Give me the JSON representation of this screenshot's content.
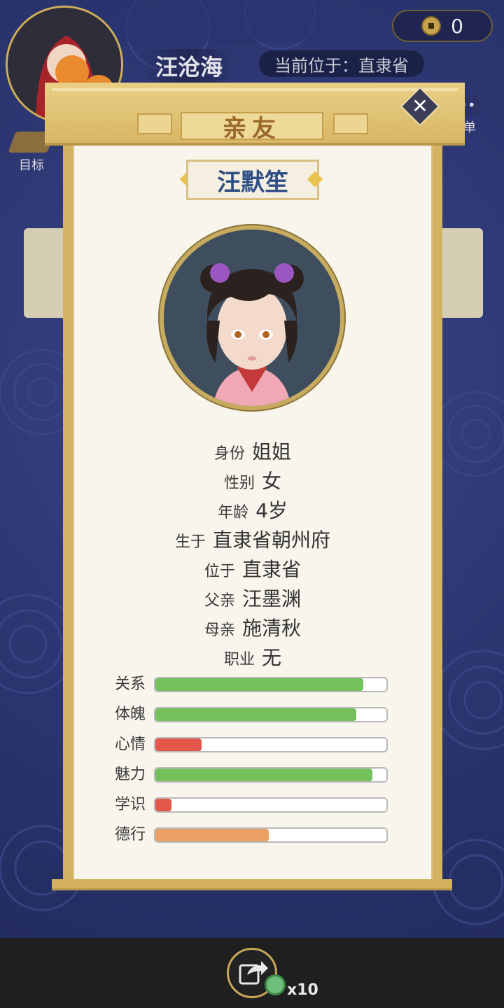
{
  "hud": {
    "player_name": "汪沧海",
    "location_text": "当前位于：直隶省",
    "coins": "0",
    "goal_label": "目标",
    "menu_label": "菜单"
  },
  "modal": {
    "title": "亲友",
    "person_name": "汪默笙",
    "info": [
      {
        "label": "身份",
        "value": "姐姐"
      },
      {
        "label": "性别",
        "value": "女"
      },
      {
        "label": "年龄",
        "value": "4岁"
      },
      {
        "label": "生于",
        "value": "直隶省朝州府"
      },
      {
        "label": "位于",
        "value": "直隶省"
      },
      {
        "label": "父亲",
        "value": "汪墨渊"
      },
      {
        "label": "母亲",
        "value": "施清秋"
      },
      {
        "label": "职业",
        "value": "无"
      }
    ],
    "stats": [
      {
        "label": "关系",
        "value": 0.9,
        "color": "#74c05a"
      },
      {
        "label": "体魄",
        "value": 0.87,
        "color": "#74c05a"
      },
      {
        "label": "心情",
        "value": 0.2,
        "color": "#e2574a"
      },
      {
        "label": "魅力",
        "value": 0.94,
        "color": "#74c05a"
      },
      {
        "label": "学识",
        "value": 0.07,
        "color": "#e2574a"
      },
      {
        "label": "德行",
        "value": 0.49,
        "color": "#eba064"
      }
    ]
  },
  "bottom": {
    "share_count": "x10"
  },
  "icons": {
    "close": "close-icon",
    "share": "share-icon",
    "coin": "coin-icon",
    "jade": "jade-token-icon"
  }
}
